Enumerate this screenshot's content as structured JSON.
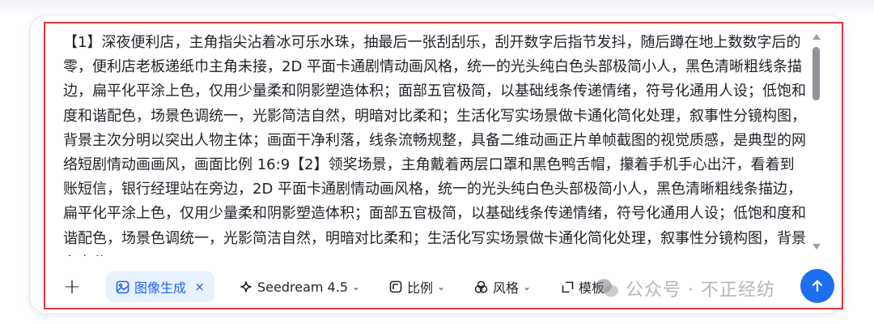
{
  "prompt": {
    "text": "【1】深夜便利店，主角指尖沾着冰可乐水珠，抽最后一张刮刮乐，刮开数字后指节发抖，随后蹲在地上数数字后的零，便利店老板递纸巾主角未接，2D 平面卡通剧情动画风格，统一的光头纯白色头部极简小人，黑色清晰粗线条描边，扁平化平涂上色，仅用少量柔和阴影塑造体积；面部五官极简，以基础线条传递情绪，符号化通用人设；低饱和度和谐配色，场景色调统一，光影简洁自然，明暗对比柔和；生活化写实场景做卡通化简化处理，叙事性分镜构图，背景主次分明以突出人物主体；画面干净利落，线条流畅规整，具备二维动画正片单帧截图的视觉质感，是典型的网络短剧情动画画风，画面比例 16:9【2】领奖场景，主角戴着两层口罩和黑色鸭舌帽，攥着手机手心出汗，看着到账短信，银行经理站在旁边，2D 平面卡通剧情动画风格，统一的光头纯白色头部极简小人，黑色清晰粗线条描边，扁平化平涂上色，仅用少量柔和阴影塑造体积；面部五官极简，以基础线条传递情绪，符号化通用人设；低饱和度和谐配色，场景色调统一，光影简洁自然，明暗对比柔和；生活化写实场景做卡通化简化处理，叙事性分镜构图，背景主次分"
  },
  "toolbar": {
    "plus": "+",
    "mode_chip": {
      "label": "图像生成",
      "close": "×",
      "icon": "image-icon"
    },
    "model": {
      "label": "Seedream 4.5",
      "caret": "⌄",
      "icon": "sparkle-icon"
    },
    "ratio": {
      "label": "比例",
      "caret": "⌄",
      "icon": "aspect-ratio-icon"
    },
    "style": {
      "label": "风格",
      "caret": "⌄",
      "icon": "palette-icon"
    },
    "template": {
      "label": "模板",
      "icon": "template-icon"
    }
  },
  "watermark": {
    "text": "公众号 · 不正经纺"
  },
  "colors": {
    "accent": "#1e6ff0",
    "chip_bg": "#e8f1fe",
    "highlight": "#e8323c"
  }
}
